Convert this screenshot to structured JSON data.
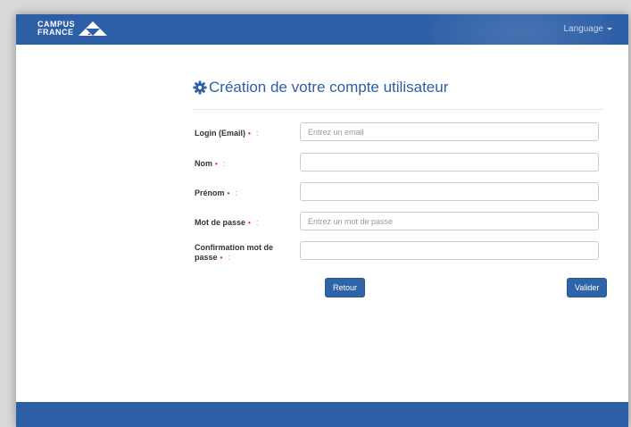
{
  "header": {
    "logo_line1": "CAMPUS",
    "logo_line2": "FRANCE",
    "language_label": "Language"
  },
  "form": {
    "title": "Création de votre compte utilisateur",
    "fields": [
      {
        "label": "Login (Email)",
        "placeholder": "Entrez un email",
        "value": ""
      },
      {
        "label": "Nom",
        "placeholder": "",
        "value": ""
      },
      {
        "label": "Prénom",
        "placeholder": "",
        "value": ""
      },
      {
        "label": "Mot de passe",
        "placeholder": "Entrez un mot de passe",
        "value": ""
      },
      {
        "label": "Confirmation mot de passe",
        "placeholder": "",
        "value": ""
      }
    ],
    "required_marker": "•",
    "colon": ":",
    "back_button": "Retour",
    "submit_button": "Valider"
  },
  "colors": {
    "brand_blue": "#2d5fa6",
    "required_red": "#d9232d"
  },
  "icons": {
    "title_icon": "gear-icon",
    "logo_icon": "triangles-logo-icon",
    "language_icon": "caret-down-icon"
  }
}
